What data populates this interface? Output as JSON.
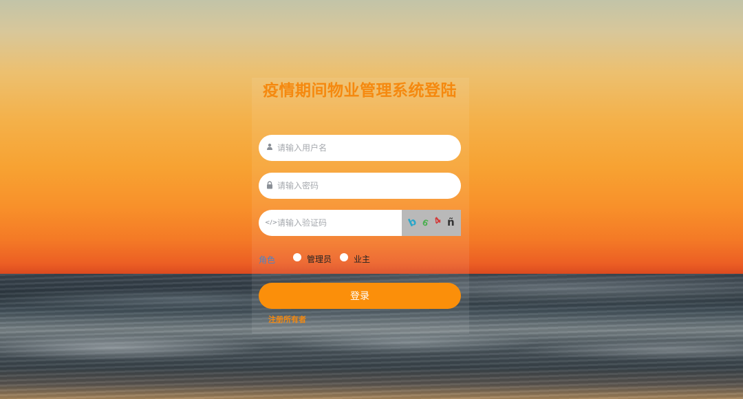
{
  "title": "疫情期间物业管理系统登陆",
  "username": {
    "placeholder": "请输入用户名",
    "icon": "user-icon"
  },
  "password": {
    "placeholder": "请输入密码",
    "icon": "lock-icon"
  },
  "captcha": {
    "placeholder": "请输入验证码",
    "icon": "code-icon",
    "chars": [
      "b",
      "6",
      "4",
      "ñ"
    ],
    "char_colors": [
      "#2aa6c9",
      "#4caf50",
      "#d23a3a",
      "#333333"
    ]
  },
  "role": {
    "label": "角色",
    "options": [
      "管理员",
      "业主"
    ]
  },
  "login_label": "登录",
  "register_label": "注册所有者",
  "colors": {
    "accent": "#fb8f0a",
    "title": "#f5890f",
    "role_label": "#4b83c7"
  }
}
